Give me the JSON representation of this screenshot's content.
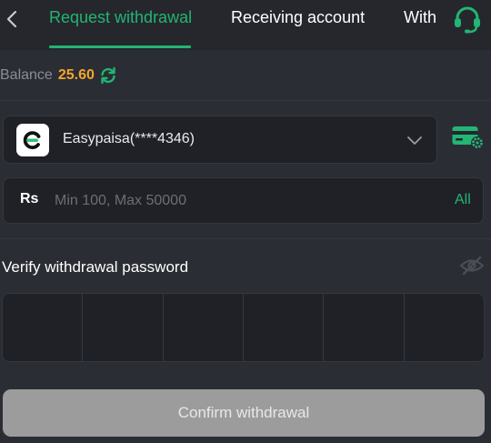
{
  "nav": {
    "tabs": [
      {
        "label": "Request withdrawal",
        "active": true
      },
      {
        "label": "Receiving account",
        "active": false
      },
      {
        "label": "With",
        "active": false
      }
    ],
    "back_icon": "chevron-left-icon",
    "support_icon": "headset-icon"
  },
  "balance": {
    "label": "Balance",
    "value": "25.60",
    "refresh_icon": "refresh-icon"
  },
  "account": {
    "name": "Easypaisa(****4346)",
    "logo_icon": "easypaisa-logo-icon",
    "dropdown_icon": "chevron-down-icon",
    "manage_icon": "card-settings-icon"
  },
  "amount": {
    "currency": "Rs",
    "placeholder": "Min 100, Max 50000",
    "all_label": "All"
  },
  "password": {
    "label": "Verify withdrawal password",
    "visibility_icon": "eye-off-icon",
    "digits": 6
  },
  "confirm": {
    "label": "Confirm withdrawal"
  },
  "colors": {
    "accent": "#22b573",
    "balance": "#f3a62b",
    "background": "#2b2d34",
    "field": "#1f2126",
    "button_disabled": "#9c9c9c"
  }
}
